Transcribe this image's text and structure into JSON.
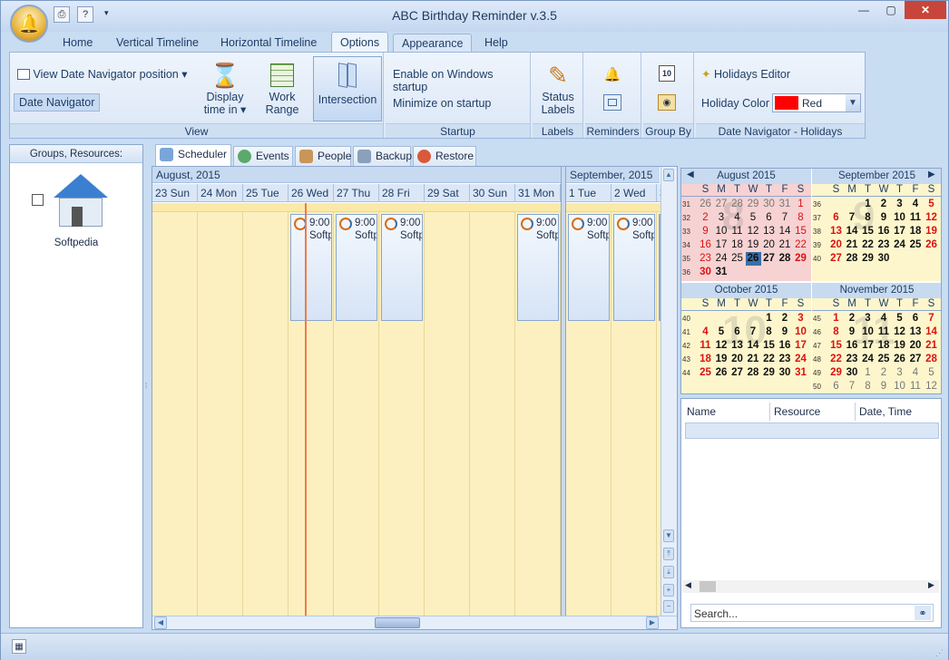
{
  "window": {
    "title": "ABC Birthday Reminder v.3.5"
  },
  "ribbon_tabs": [
    "Home",
    "Vertical Timeline",
    "Horizontal Timeline",
    "Options",
    "Appearance",
    "Help"
  ],
  "ribbon": {
    "view": {
      "label": "View",
      "nav_pos": "View Date Navigator position",
      "date_nav": "Date Navigator",
      "display_time": "Display",
      "display_time2": "time in",
      "work_range": "Work",
      "work_range2": "Range",
      "intersection": "Intersection"
    },
    "startup": {
      "label": "Startup",
      "enable": "Enable on Windows startup",
      "minimize": "Minimize on startup"
    },
    "labels": {
      "label": "Labels",
      "status": "Status",
      "status2": "Labels"
    },
    "reminders": {
      "label": "Reminders"
    },
    "groupby": {
      "label": "Group By"
    },
    "holidays": {
      "label": "Date Navigator - Holidays",
      "editor": "Holidays Editor",
      "color_label": "Holiday Color",
      "color_value": "Red",
      "color_hex": "#ff0000"
    }
  },
  "left_panel": {
    "header": "Groups, Resources:",
    "resource": "Softpedia"
  },
  "sched_tabs": [
    "Scheduler",
    "Events",
    "People",
    "Backup",
    "Restore"
  ],
  "scheduler": {
    "month1": "August, 2015",
    "month2": "September, 2015",
    "days": [
      "23 Sun",
      "24 Mon",
      "25 Tue",
      "26 Wed",
      "27 Thu",
      "28 Fri",
      "29 Sat",
      "30 Sun",
      "31 Mon"
    ],
    "days2": [
      "1 Tue",
      "2 Wed",
      "3"
    ],
    "appt_time": "9:00",
    "appt_text": "Softp"
  },
  "calendar": {
    "dow": [
      "S",
      "M",
      "T",
      "W",
      "T",
      "F",
      "S"
    ],
    "aug": {
      "title": "August 2015",
      "weeks": [
        "31",
        "32",
        "33",
        "34",
        "35",
        "36"
      ],
      "rows": [
        [
          "26",
          "27",
          "28",
          "29",
          "30",
          "31",
          "1"
        ],
        [
          "2",
          "3",
          "4",
          "5",
          "6",
          "7",
          "8"
        ],
        [
          "9",
          "10",
          "11",
          "12",
          "13",
          "14",
          "15"
        ],
        [
          "16",
          "17",
          "18",
          "19",
          "20",
          "21",
          "22"
        ],
        [
          "23",
          "24",
          "25",
          "26",
          "27",
          "28",
          "29"
        ],
        [
          "30",
          "31",
          "",
          "",
          "",
          "",
          ""
        ]
      ]
    },
    "sep": {
      "title": "September 2015",
      "weeks": [
        "36",
        "37",
        "38",
        "39",
        "40"
      ],
      "rows": [
        [
          "",
          "",
          "1",
          "2",
          "3",
          "4",
          "5"
        ],
        [
          "6",
          "7",
          "8",
          "9",
          "10",
          "11",
          "12"
        ],
        [
          "13",
          "14",
          "15",
          "16",
          "17",
          "18",
          "19"
        ],
        [
          "20",
          "21",
          "22",
          "23",
          "24",
          "25",
          "26"
        ],
        [
          "27",
          "28",
          "29",
          "30",
          "",
          "",
          ""
        ]
      ]
    },
    "oct": {
      "title": "October 2015",
      "weeks": [
        "40",
        "41",
        "42",
        "43",
        "44"
      ],
      "rows": [
        [
          "",
          "",
          "",
          "",
          "1",
          "2",
          "3"
        ],
        [
          "4",
          "5",
          "6",
          "7",
          "8",
          "9",
          "10"
        ],
        [
          "11",
          "12",
          "13",
          "14",
          "15",
          "16",
          "17"
        ],
        [
          "18",
          "19",
          "20",
          "21",
          "22",
          "23",
          "24"
        ],
        [
          "25",
          "26",
          "27",
          "28",
          "29",
          "30",
          "31"
        ]
      ]
    },
    "nov": {
      "title": "November 2015",
      "weeks": [
        "45",
        "46",
        "47",
        "48",
        "49",
        "50"
      ],
      "rows": [
        [
          "1",
          "2",
          "3",
          "4",
          "5",
          "6",
          "7"
        ],
        [
          "8",
          "9",
          "10",
          "11",
          "12",
          "13",
          "14"
        ],
        [
          "15",
          "16",
          "17",
          "18",
          "19",
          "20",
          "21"
        ],
        [
          "22",
          "23",
          "24",
          "25",
          "26",
          "27",
          "28"
        ],
        [
          "29",
          "30",
          "1",
          "2",
          "3",
          "4",
          "5"
        ],
        [
          "6",
          "7",
          "8",
          "9",
          "10",
          "11",
          "12"
        ]
      ]
    }
  },
  "list": {
    "cols": [
      "Name",
      "Resource",
      "Date, Time"
    ],
    "search_placeholder": "Search..."
  }
}
